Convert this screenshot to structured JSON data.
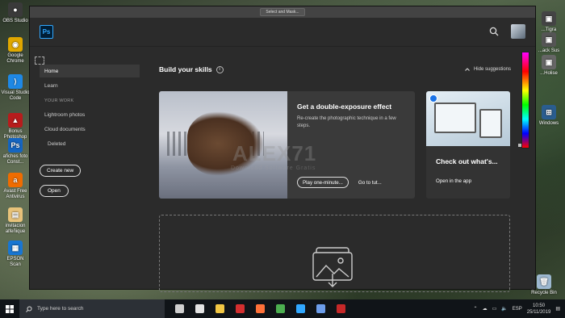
{
  "desktop": {
    "icons": [
      {
        "label": "OBS Studio",
        "color": "#3a3a3a",
        "glyph": "●"
      },
      {
        "label": "Google Chrome",
        "color": "#e0a800",
        "glyph": "◉"
      },
      {
        "label": "Visual Studio Code",
        "color": "#1e88e5",
        "glyph": "⟩"
      },
      {
        "label": "Bonus Photoshop",
        "color": "#b71c1c",
        "glyph": "▲"
      },
      {
        "label": "afiches foto Const...",
        "color": "#1565c0",
        "glyph": "Ps"
      },
      {
        "label": "Avast Free Antivirus",
        "color": "#ef6c00",
        "glyph": "a"
      },
      {
        "label": "invitacion alfeñique",
        "color": "#e8c37a",
        "glyph": "▤"
      },
      {
        "label": "EPSON Scan",
        "color": "#1976d2",
        "glyph": "▦"
      }
    ],
    "right_icons": [
      "...Tigra",
      "...ack Sus",
      "...Holise",
      "Windows"
    ],
    "recycle_bin": "Recycle Bin"
  },
  "window": {
    "select_mask_label": "Select and Mask...",
    "logo": "Ps"
  },
  "sidebar": {
    "home": "Home",
    "learn": "Learn",
    "your_work": "YOUR WORK",
    "lightroom": "Lightroom photos",
    "cloud": "Cloud documents",
    "deleted": "Deleted",
    "create_new": "Create new",
    "open": "Open"
  },
  "main": {
    "build_skills": "Build your skills",
    "info": "i",
    "hide_suggestions": "Hide suggestions",
    "card": {
      "title": "Get a double-exposure effect",
      "description": "Re-create the photographic technique in a few steps.",
      "play_button": "Play one-minute...",
      "go_to": "Go to tut..."
    },
    "side_card": {
      "title": "Check out what's...",
      "link": "Open in the app"
    }
  },
  "watermark": {
    "text": "ALEX71",
    "subtext": "Download Software Gratis"
  },
  "taskbar": {
    "search_placeholder": "Type here to search",
    "language": "ESP",
    "time": "10:50",
    "date": "25/11/2019",
    "apps": [
      {
        "name": "task-view",
        "color": "#cfcfcf"
      },
      {
        "name": "mail",
        "color": "#e3e3e3"
      },
      {
        "name": "file-explorer",
        "color": "#f2c744"
      },
      {
        "name": "camtasia",
        "color": "#d32f2f"
      },
      {
        "name": "firefox",
        "color": "#ff7139"
      },
      {
        "name": "chrome",
        "color": "#4caf50"
      },
      {
        "name": "photoshop",
        "color": "#31a8ff"
      },
      {
        "name": "store",
        "color": "#6d9eeb"
      },
      {
        "name": "app-red",
        "color": "#c62828"
      }
    ]
  }
}
